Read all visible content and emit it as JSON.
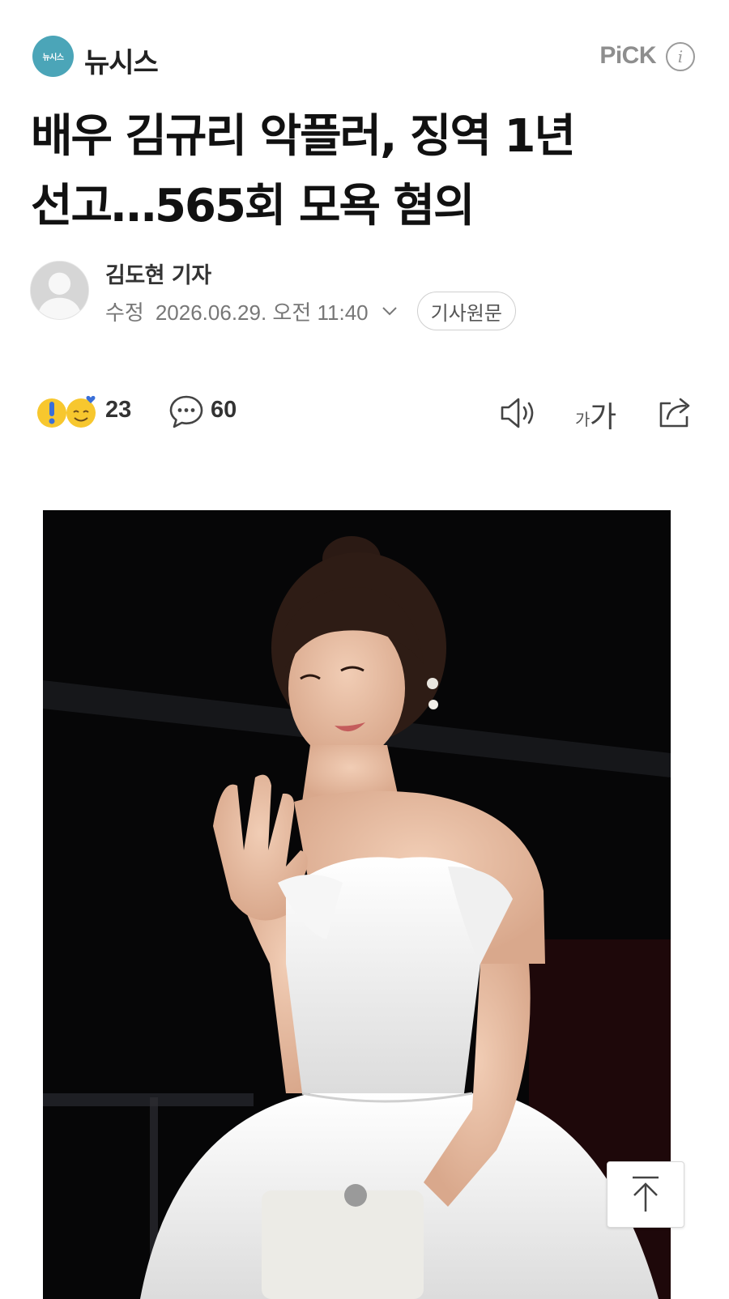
{
  "header": {
    "press_logo_text": "뉴시스",
    "press_name": "뉴시스",
    "pick_label": "PiCK",
    "info_icon": "info-icon"
  },
  "article": {
    "title_line1": "배우 김규리 악플러, 징역 1년",
    "title_line2": "선고…565회 모욕 혐의"
  },
  "byline": {
    "reporter": "김도현 기자",
    "date_label": "수정",
    "date_text": "2026.06.29. 오전 11:40",
    "original_button": "기사원문"
  },
  "toolbar": {
    "reaction_count": "23",
    "comment_count": "60",
    "font_small": "가",
    "font_big": "가"
  },
  "colors": {
    "press_logo_bg": "#4ba5b8",
    "title": "#111111",
    "muted": "#777777",
    "photo_bg": "#070708"
  },
  "icons": [
    "info-icon",
    "avatar-icon",
    "chevron-down-icon",
    "reaction-icons",
    "comment-icon",
    "speaker-icon",
    "font-size-icon",
    "share-icon",
    "arrow-up-icon"
  ]
}
